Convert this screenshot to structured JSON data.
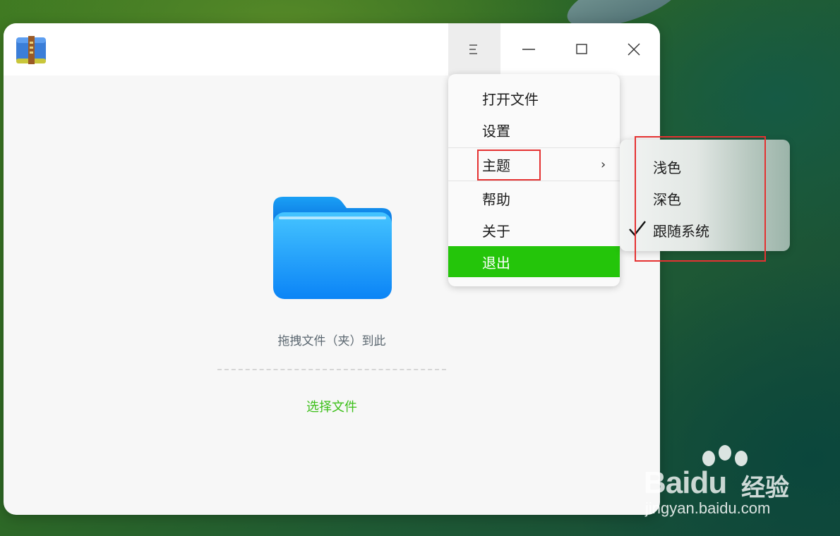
{
  "window": {
    "app_icon": "archive-folder-icon",
    "controls": [
      "menu-icon",
      "minimize-icon",
      "maximize-icon",
      "close-icon"
    ]
  },
  "main": {
    "drop_hint": "拖拽文件（夹）到此",
    "select_file_label": "选择文件",
    "accent_color": "#3cbf19"
  },
  "menu": {
    "items": [
      {
        "label": "打开文件"
      },
      {
        "label": "设置"
      },
      {
        "label": "主题",
        "has_submenu": true
      },
      {
        "label": "帮助"
      },
      {
        "label": "关于"
      },
      {
        "label": "退出",
        "highlighted": true
      }
    ],
    "highlight_color": "#24c50a"
  },
  "theme_submenu": {
    "items": [
      {
        "label": "浅色",
        "checked": false
      },
      {
        "label": "深色",
        "checked": false
      },
      {
        "label": "跟随系统",
        "checked": true
      }
    ]
  },
  "annotation": {
    "highlight_color": "#e53232"
  },
  "watermark": {
    "brand": "Baidu",
    "suffix": "经验",
    "url": "jingyan.baidu.com"
  }
}
